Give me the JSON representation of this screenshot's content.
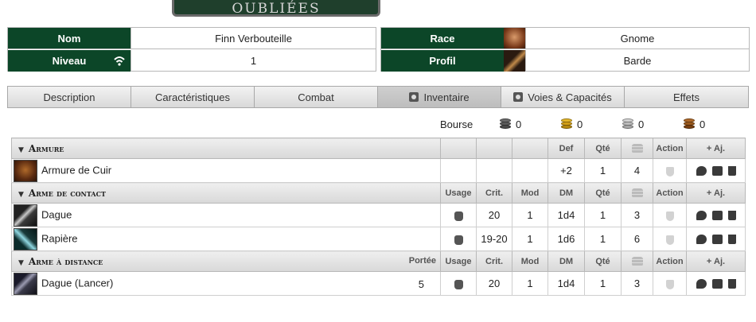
{
  "banner": {
    "text": "OUBLIÉES"
  },
  "identity": {
    "left": {
      "nom_label": "Nom",
      "nom_value": "Finn Verbouteille",
      "niveau_label": "Niveau",
      "niveau_value": "1"
    },
    "right": {
      "race_label": "Race",
      "race_value": "Gnome",
      "profil_label": "Profil",
      "profil_value": "Barde"
    }
  },
  "tabs": [
    {
      "label": "Description"
    },
    {
      "label": "Caractéristiques"
    },
    {
      "label": "Combat"
    },
    {
      "label": "Inventaire",
      "active": true
    },
    {
      "label": "Voies & Capacités"
    },
    {
      "label": "Effets"
    }
  ],
  "bourse": {
    "label": "Bourse",
    "coins": [
      {
        "name": "platinum-coins",
        "value": "0",
        "color": "#5a5a5a"
      },
      {
        "name": "gold-coins",
        "value": "0",
        "color": "#d4a017"
      },
      {
        "name": "silver-coins",
        "value": "0",
        "color": "#b9b9b9"
      },
      {
        "name": "copper-coins",
        "value": "0",
        "color": "#9c5a1c"
      }
    ]
  },
  "inventory": {
    "armure": {
      "title": "Armure",
      "col_def": "Def",
      "col_qte": "Qté",
      "col_action": "Action",
      "add": "+ Aj.",
      "items": [
        {
          "name": "Armure de Cuir",
          "def": "+2",
          "qte": "1",
          "weight": "4"
        }
      ]
    },
    "contact": {
      "title": "Arme de contact",
      "col_usage": "Usage",
      "col_crit": "Crit.",
      "col_mod": "Mod",
      "col_dm": "DM",
      "col_qte": "Qté",
      "col_action": "Action",
      "add": "+ Aj.",
      "items": [
        {
          "name": "Dague",
          "crit": "20",
          "mod": "1",
          "dm": "1d4",
          "qte": "1",
          "weight": "3"
        },
        {
          "name": "Rapière",
          "crit": "19-20",
          "mod": "1",
          "dm": "1d6",
          "qte": "1",
          "weight": "6"
        }
      ]
    },
    "distance": {
      "title": "Arme à distance",
      "col_portee": "Portée",
      "col_usage": "Usage",
      "col_crit": "Crit.",
      "col_mod": "Mod",
      "col_dm": "DM",
      "col_qte": "Qté",
      "col_action": "Action",
      "add": "+ Aj.",
      "items": [
        {
          "name": "Dague (Lancer)",
          "portee": "5",
          "crit": "20",
          "mod": "1",
          "dm": "1d4",
          "qte": "1",
          "weight": "3"
        }
      ]
    }
  }
}
